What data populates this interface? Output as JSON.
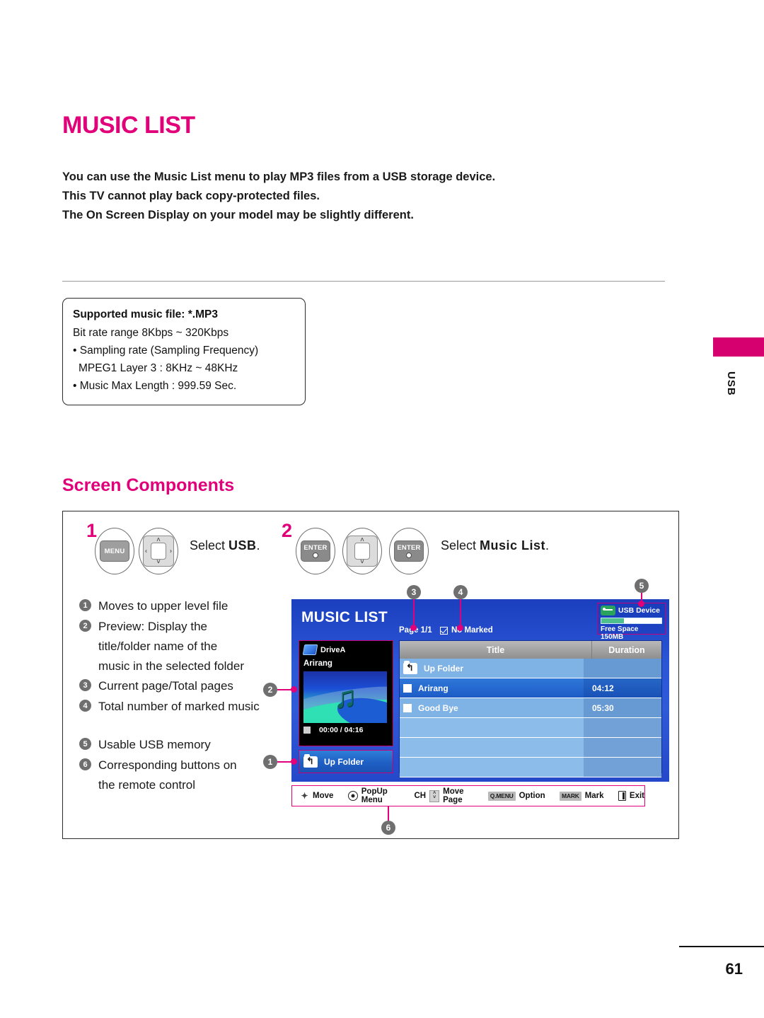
{
  "page": {
    "title": "MUSIC LIST",
    "number": "61",
    "side_tab": "USB",
    "accent_color": "#e2007a"
  },
  "intro": {
    "line1": "You can use the Music List menu to play MP3 files from a USB storage device.",
    "line2": "This TV cannot play back copy-protected files.",
    "line3": "The On Screen Display on your model may be slightly different."
  },
  "supported_box": {
    "heading": "Supported music file: *.MP3",
    "line1": "Bit rate range 8Kbps ~ 320Kbps",
    "line2": "• Sampling rate (Sampling Frequency)",
    "line3": "MPEG1 Layer 3 : 8KHz ~ 48KHz",
    "line4": "• Music Max Length : 999.59 Sec."
  },
  "screen_components": {
    "heading": "Screen Components",
    "steps": [
      {
        "num": "1",
        "keys": [
          "MENU",
          "nav4"
        ],
        "menu_label": "MENU",
        "text_prefix": "Select ",
        "text_bold": "USB",
        "text_suffix": "."
      },
      {
        "num": "2",
        "keys": [
          "ENTER",
          "nav2",
          "ENTER"
        ],
        "enter_label": "ENTER",
        "text_prefix": "Select ",
        "text_bold": "Music List",
        "text_suffix": "."
      }
    ],
    "legend": [
      {
        "num": "1",
        "text": "Moves to upper level file"
      },
      {
        "num": "2",
        "text": "Preview: Display the",
        "cont1": "title/folder name of the",
        "cont2": "music in the selected folder"
      },
      {
        "num": "3",
        "text": "Current page/Total pages"
      },
      {
        "num": "4",
        "text": "Total number of marked music"
      },
      {
        "num": "5",
        "text": "Usable USB memory"
      },
      {
        "num": "6",
        "text": "Corresponding buttons on",
        "cont1": "the remote control"
      }
    ],
    "callouts": [
      "1",
      "2",
      "3",
      "4",
      "5",
      "6"
    ]
  },
  "tv_screen": {
    "title": "MUSIC LIST",
    "page_indicator": "Page 1/1",
    "marked_status": "No Marked",
    "usb_device": {
      "label": "USB Device",
      "free_space": "Free Space 150MB",
      "icon": "usb-icon"
    },
    "preview": {
      "drive_name": "DriveA",
      "drive_icon": "folder-icon",
      "song_title": "Arirang",
      "album_art_icon": "music-note-icon",
      "stop_icon": "stop-icon",
      "time": "00:00 / 04:16"
    },
    "up_folder_button": {
      "label": "Up Folder",
      "icon": "folder-up-icon"
    },
    "table": {
      "columns": [
        "Title",
        "Duration"
      ],
      "rows": [
        {
          "icon": "folder-up-icon",
          "title": "Up Folder",
          "duration": "",
          "selected": false,
          "is_folder": true
        },
        {
          "icon": "checkbox-icon",
          "title": "Arirang",
          "duration": "04:12",
          "selected": true,
          "is_folder": false
        },
        {
          "icon": "checkbox-icon",
          "title": "Good Bye",
          "duration": "05:30",
          "selected": false,
          "is_folder": false
        }
      ],
      "empty_rows": 3
    },
    "button_bar": [
      {
        "icon": "dpad-icon",
        "label": "Move"
      },
      {
        "icon": "ok-circle-icon",
        "label": "PopUp Menu"
      },
      {
        "icon": "ch-updown-icon",
        "prefix": "CH",
        "label": "Move Page"
      },
      {
        "icon": "qmenu-key-icon",
        "key": "Q.MENU",
        "label": "Option"
      },
      {
        "icon": "mark-key-icon",
        "key": "MARK",
        "label": "Mark"
      },
      {
        "icon": "exit-door-icon",
        "label": "Exit"
      }
    ]
  }
}
